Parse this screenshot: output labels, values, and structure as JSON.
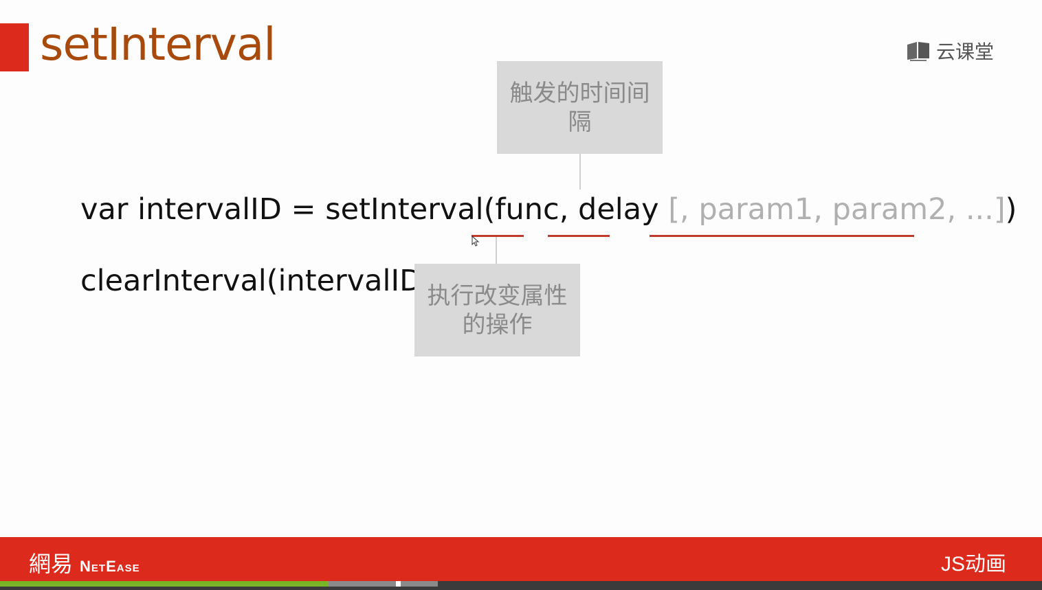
{
  "slide": {
    "title": "setInterval",
    "brand_label": "云课堂",
    "code_line1": {
      "main": "var intervalID = setInterval(func, delay ",
      "optional": "[, param1, param2, ...]",
      "close": ")"
    },
    "code_line2": "clearInterval(intervalID)",
    "callout_delay": "触发的时间间隔",
    "callout_func": "执行改变属性的操作"
  },
  "footer": {
    "logo_cn": "網易",
    "logo_en": "NetEase",
    "course": "JS动画"
  },
  "player": {
    "progress_fraction": 0.315,
    "buffered_fraction": 0.42
  },
  "colors": {
    "accent_red": "#dc2a1c",
    "title_brown": "#a84a0c",
    "underline_red": "#c0392b"
  }
}
